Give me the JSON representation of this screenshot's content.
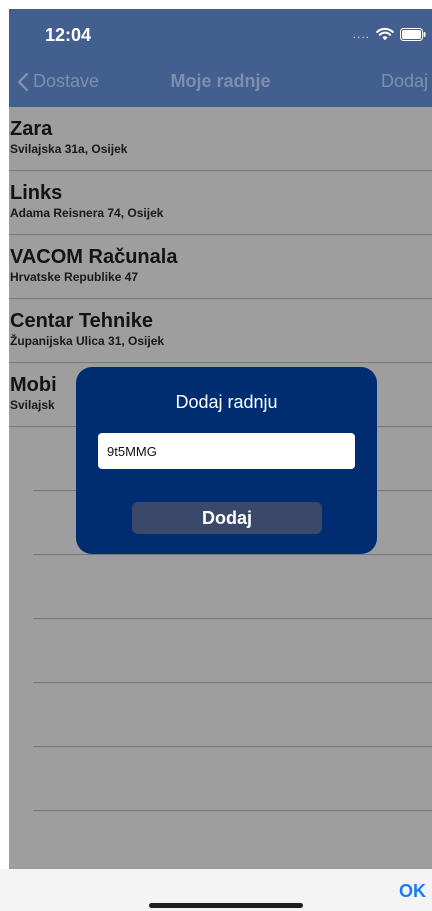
{
  "status_bar": {
    "time": "12:04",
    "signal": "....",
    "colors": {
      "bar": "#425f8f"
    }
  },
  "nav": {
    "back_label": "Dostave",
    "title": "Moje radnje",
    "add_label": "Dodaj"
  },
  "stores": [
    {
      "name": "Zara",
      "address": "Svilajska 31a, Osijek"
    },
    {
      "name": "Links",
      "address": "Adama Reisnera 74, Osijek"
    },
    {
      "name": "VACOM Računala",
      "address": "Hrvatske Republike 47"
    },
    {
      "name": "Centar Tehnike",
      "address": "Županijska Ulica 31, Osijek"
    },
    {
      "name": "Mobi",
      "address": "Svilajsk"
    }
  ],
  "dialog": {
    "title": "Dodaj radnju",
    "input_value": "9t5MMG",
    "button_label": "Dodaj",
    "colors": {
      "background": "#002d72",
      "button": "#3a4869"
    }
  },
  "bottom_bar": {
    "ok_label": "OK",
    "colors": {
      "ok": "#1a7cf5"
    }
  },
  "icons": [
    "chevron-left-icon",
    "wifi-icon",
    "battery-icon"
  ]
}
